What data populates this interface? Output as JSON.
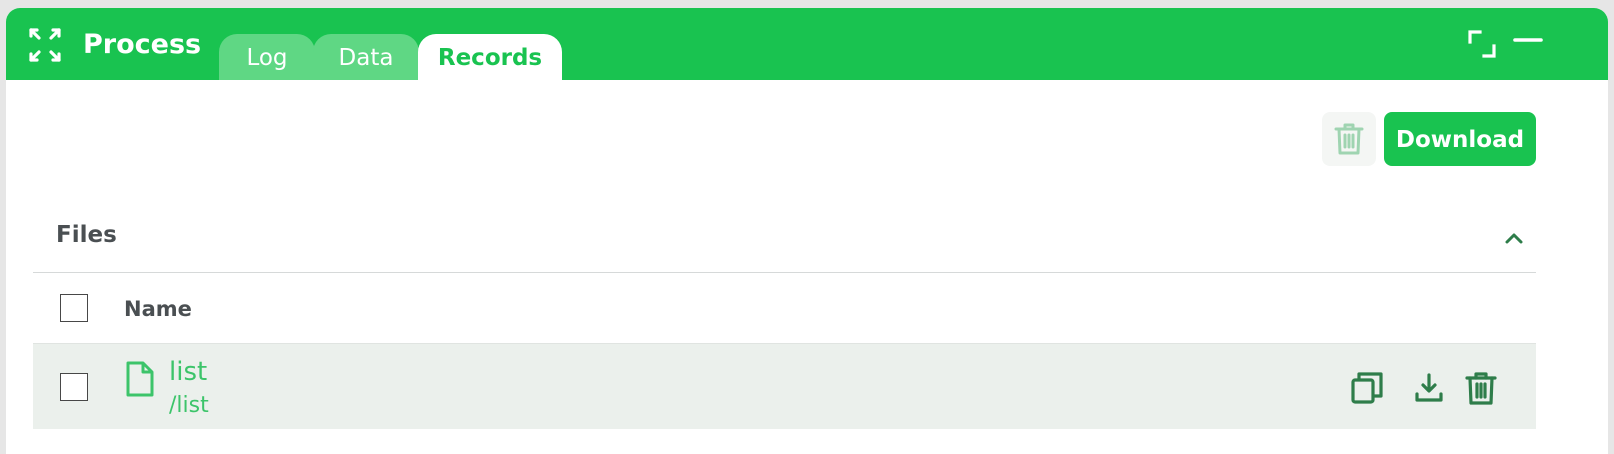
{
  "header": {
    "title": "Process",
    "tabs": [
      {
        "label": "Log",
        "active": false
      },
      {
        "label": "Data",
        "active": false
      },
      {
        "label": "Records",
        "active": true
      }
    ],
    "icons": [
      "process-icon",
      "expand-icon",
      "minimize-icon"
    ]
  },
  "toolbar": {
    "trash_icon": "trash-icon",
    "download_label": "Download"
  },
  "files_section": {
    "title": "Files",
    "collapse_icon": "chevron-up-icon",
    "columns": [
      "Name"
    ],
    "rows": [
      {
        "name": "list",
        "path": "/list",
        "icon": "file-icon",
        "actions": [
          "copy-icon",
          "download-icon",
          "trash-icon"
        ]
      }
    ]
  },
  "colors": {
    "brand_green": "#19c350",
    "inactive_tab": "#5fd784",
    "file_text": "#3cc46a",
    "action_icon": "#2e7d4a",
    "row_bg": "#ebf0ec"
  }
}
